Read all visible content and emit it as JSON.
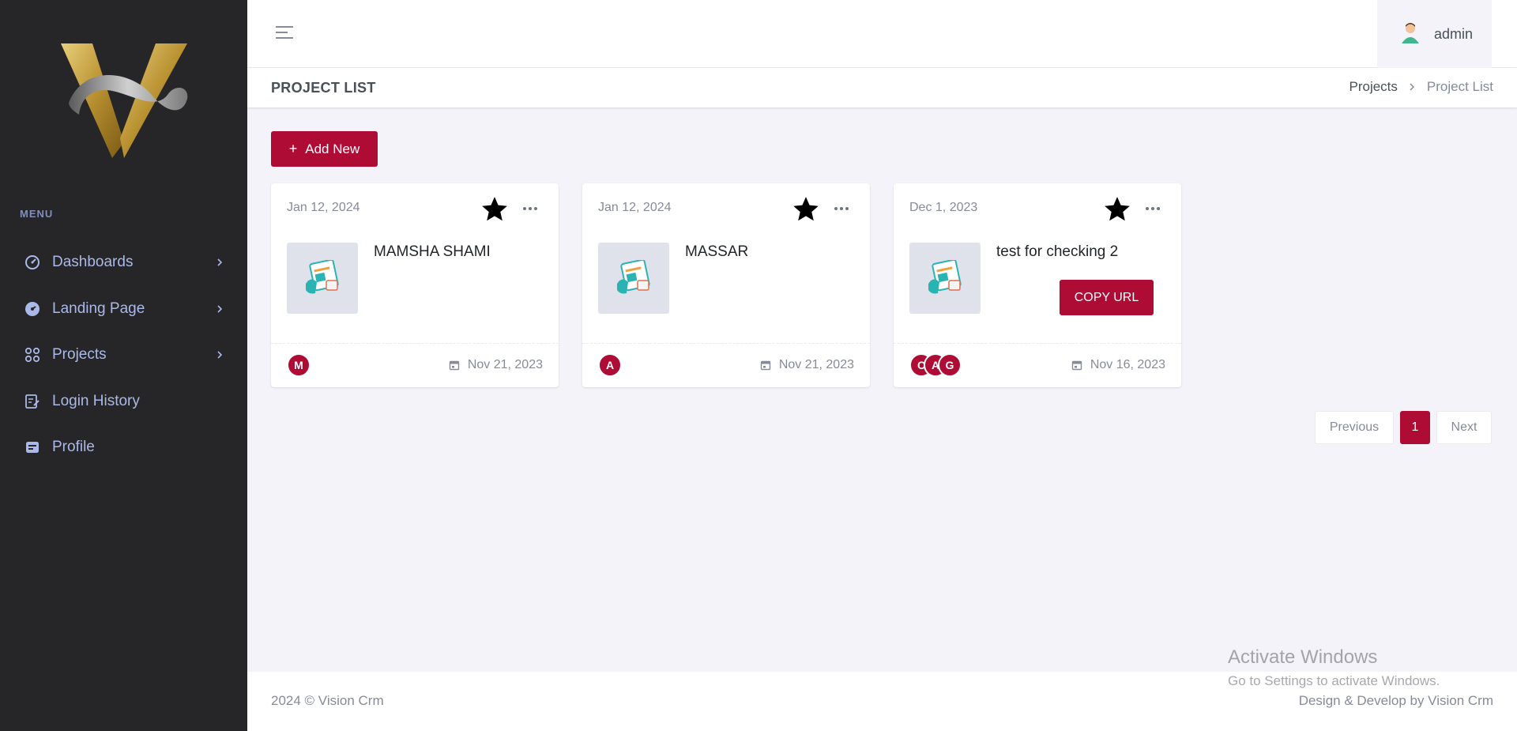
{
  "app": {
    "brand_logo": "V"
  },
  "sidebar": {
    "menu_title": "MENU",
    "items": [
      {
        "label": "Dashboards",
        "icon": "dashboard-gauge-icon",
        "has_children": true
      },
      {
        "label": "Landing Page",
        "icon": "speedometer-icon",
        "has_children": true
      },
      {
        "label": "Projects",
        "icon": "apps-grid-icon",
        "has_children": true
      },
      {
        "label": "Login History",
        "icon": "edit-log-icon",
        "has_children": false
      },
      {
        "label": "Profile",
        "icon": "profile-card-icon",
        "has_children": false
      }
    ]
  },
  "topbar": {
    "username": "admin"
  },
  "page": {
    "title": "PROJECT LIST",
    "breadcrumb": [
      "Projects",
      "Project List"
    ]
  },
  "toolbar": {
    "add_label": "Add New"
  },
  "projects": [
    {
      "date": "Jan 12, 2024",
      "name": "MAMSHA SHAMI",
      "members": [
        "M"
      ],
      "footer_date": "Nov 21, 2023",
      "starred": true
    },
    {
      "date": "Jan 12, 2024",
      "name": "MASSAR",
      "members": [
        "A"
      ],
      "footer_date": "Nov 21, 2023",
      "starred": true
    },
    {
      "date": "Dec 1, 2023",
      "name": "test for checking 2",
      "members": [
        "C",
        "A",
        "G"
      ],
      "footer_date": "Nov 16, 2023",
      "starred": true,
      "copy_label": "COPY URL"
    }
  ],
  "pagination": {
    "previous": "Previous",
    "current": "1",
    "next": "Next"
  },
  "footer": {
    "copyright": "2024 © Vision Crm",
    "credit": "Design & Develop by Vision Crm"
  },
  "watermark": {
    "line1": "Activate Windows",
    "line2": "Go to Settings to activate Windows."
  },
  "colors": {
    "accent": "#ae0b35",
    "sidebar_bg": "#262527",
    "page_bg": "#f3f3f9",
    "gold": "#c9a24a"
  }
}
